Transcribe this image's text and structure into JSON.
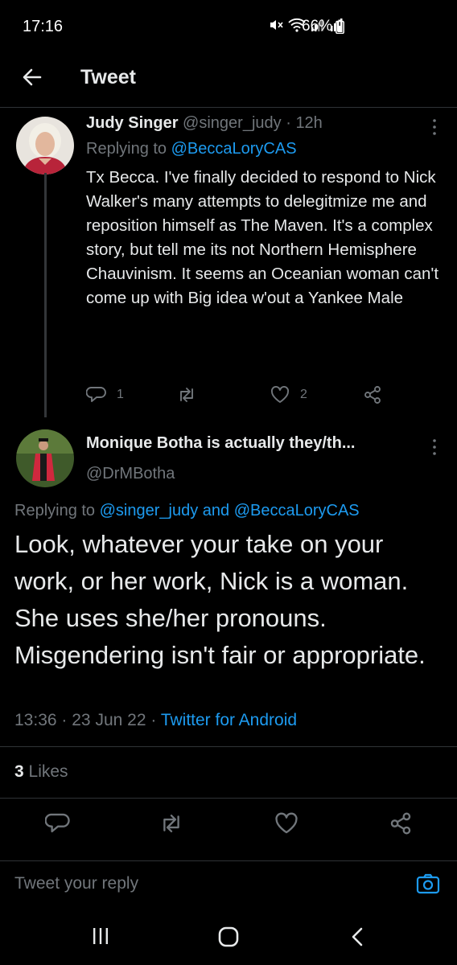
{
  "status_bar": {
    "time": "17:16",
    "battery": "66%"
  },
  "header": {
    "title": "Tweet"
  },
  "tweet1": {
    "name": "Judy Singer",
    "handle": "@singer_judy",
    "time_sep": "·",
    "time": "12h",
    "replying_prefix": "Replying to",
    "replying_to": "@BeccaLoryCAS",
    "text": "Tx Becca. I've finally decided to respond to Nick Walker's many attempts to delegitmize me and reposition himself as The Maven. It's a complex story, but tell me its not Northern Hemisphere Chauvinism. It seems an Oceanian woman can't come up with Big idea w'out a Yankee Male",
    "reply_count": "1",
    "like_count": "2"
  },
  "tweet2": {
    "name": "Monique Botha is actually they/th...",
    "handle": "@DrMBotha",
    "replying_prefix": "Replying to",
    "replying_to_1": "@singer_judy",
    "replying_and": "and",
    "replying_to_2": "@BeccaLoryCAS",
    "text": "Look, whatever your take on your work, or her work, Nick is a woman. She uses she/her pronouns. Misgendering isn't fair or appropriate.",
    "time": "13:36",
    "sep1": "·",
    "date": "23 Jun 22",
    "sep2": "·",
    "client": "Twitter for Android",
    "likes_count": "3",
    "likes_label": "Likes"
  },
  "reply_bar": {
    "placeholder": "Tweet your reply"
  },
  "icons": {
    "back": "arrow-left-icon",
    "more": "more-vertical-icon",
    "reply": "reply-icon",
    "retweet": "retweet-icon",
    "like": "heart-icon",
    "share": "share-icon",
    "camera": "camera-icon"
  },
  "colors": {
    "accent": "#1d9bf0",
    "muted": "#71767b",
    "text": "#e7e9ea",
    "background": "#000000"
  }
}
